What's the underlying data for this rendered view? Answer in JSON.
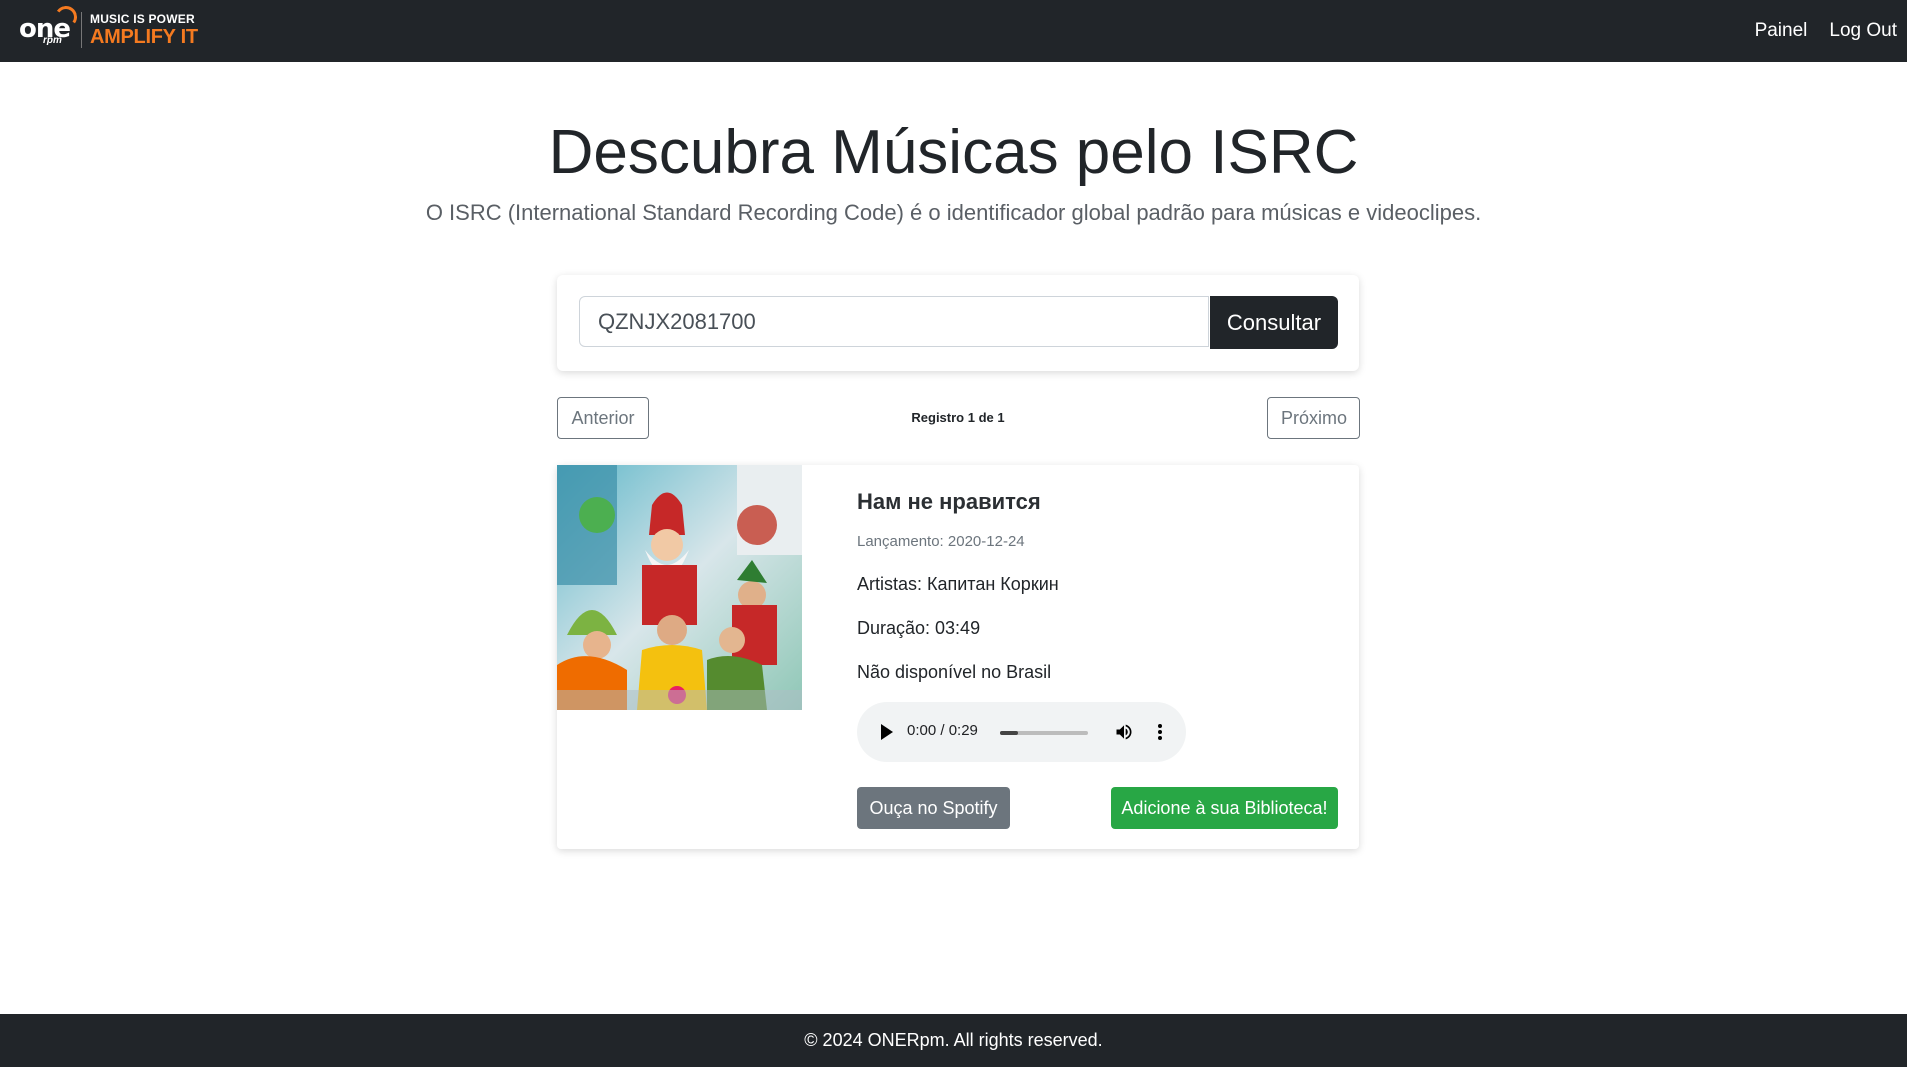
{
  "brand": {
    "logo_text": "one",
    "logo_sub": "rpm",
    "tagline_top": "MUSIC IS POWER",
    "tagline_bottom": "AMPLIFY IT",
    "accent_color": "#f47a20"
  },
  "nav": {
    "links": [
      {
        "label": "Painel"
      },
      {
        "label": "Log Out"
      }
    ]
  },
  "hero": {
    "title": "Descubra Músicas pelo ISRC",
    "subtitle": "O ISRC (International Standard Recording Code) é o identificador global padrão para músicas e videoclipes."
  },
  "search": {
    "value": "QZNJX2081700",
    "button_label": "Consultar"
  },
  "pagination": {
    "prev_label": "Anterior",
    "next_label": "Próximo",
    "record_info": "Registro 1 de 1"
  },
  "result": {
    "title": "Нам не нравится",
    "release": "Lançamento: 2020-12-24",
    "artists": "Artistas: Капитан Коркин",
    "duration": "Duração: 03:49",
    "availability": "Não disponível no Brasil",
    "player": {
      "time": "0:00 / 0:29",
      "volume_level": 0.2
    },
    "spotify_label": "Ouça no Spotify",
    "library_label": "Adicione à sua Biblioteca!"
  },
  "footer": {
    "text": "© 2024 ONERpm. All rights reserved."
  },
  "colors": {
    "navbar_bg": "#212529",
    "secondary": "#6c757d",
    "success": "#28a745"
  }
}
